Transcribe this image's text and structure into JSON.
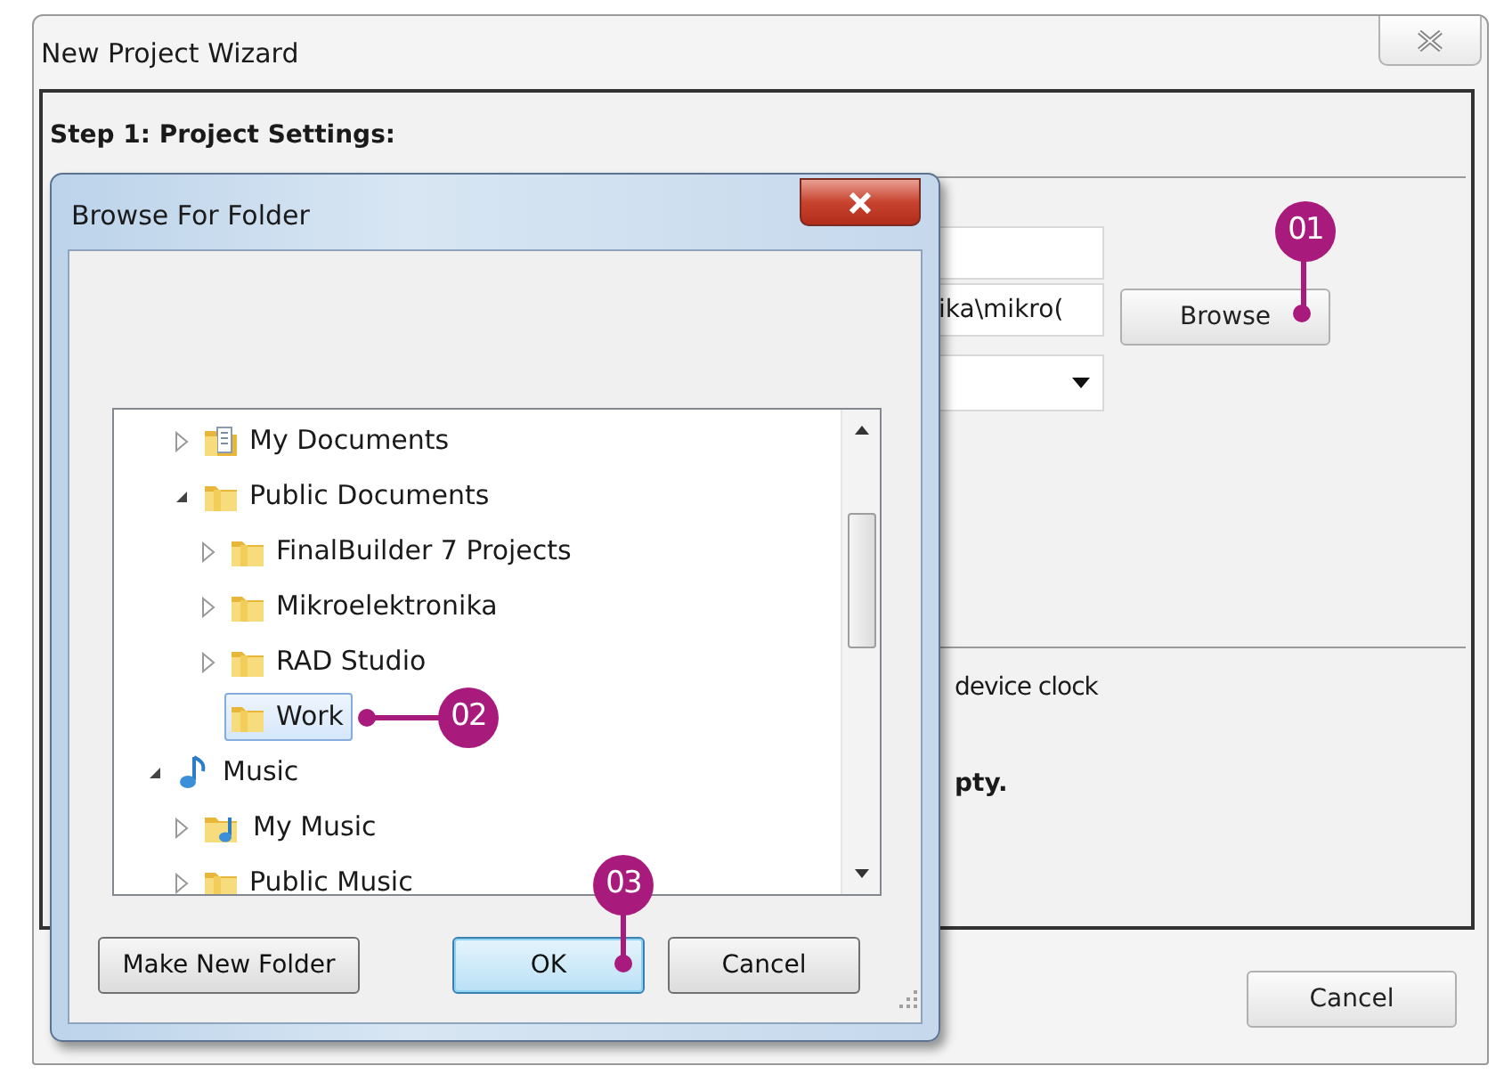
{
  "wizard": {
    "title": "New Project Wizard",
    "step_heading": "Step 1: Project Settings:",
    "path_field": {
      "value": "ika\\mikro("
    },
    "browse_button": "Browse",
    "option_text": "device clock",
    "note_text": "pty.",
    "cancel_button": "Cancel"
  },
  "dialog": {
    "title": "Browse For Folder",
    "tree": [
      {
        "children": [
          {
            "label": "My Documents",
            "kind": "documents",
            "expanded": false,
            "selected": false
          },
          {
            "label": "Public Documents",
            "kind": "folder",
            "expanded": true,
            "selected": false,
            "children": [
              {
                "label": "FinalBuilder 7 Projects",
                "kind": "folder",
                "expanded": false,
                "selected": false
              },
              {
                "label": "Mikroelektronika",
                "kind": "folder",
                "expanded": false,
                "selected": false
              },
              {
                "label": "RAD Studio",
                "kind": "folder",
                "expanded": false,
                "selected": false
              },
              {
                "label": "Work",
                "kind": "folder",
                "selected": true
              }
            ]
          }
        ]
      },
      {
        "label": "Music",
        "kind": "music",
        "expanded": true,
        "selected": false,
        "children": [
          {
            "label": "My Music",
            "kind": "music-folder",
            "expanded": false,
            "selected": false
          },
          {
            "label": "Public Music",
            "kind": "folder",
            "expanded": false,
            "selected": false
          }
        ]
      }
    ],
    "buttons": [
      {
        "label": "Make New Folder",
        "default": false
      },
      {
        "label": "OK",
        "default": true
      },
      {
        "label": "Cancel",
        "default": false
      }
    ]
  },
  "callouts": [
    {
      "label": "01"
    },
    {
      "label": "02"
    },
    {
      "label": "03"
    }
  ]
}
